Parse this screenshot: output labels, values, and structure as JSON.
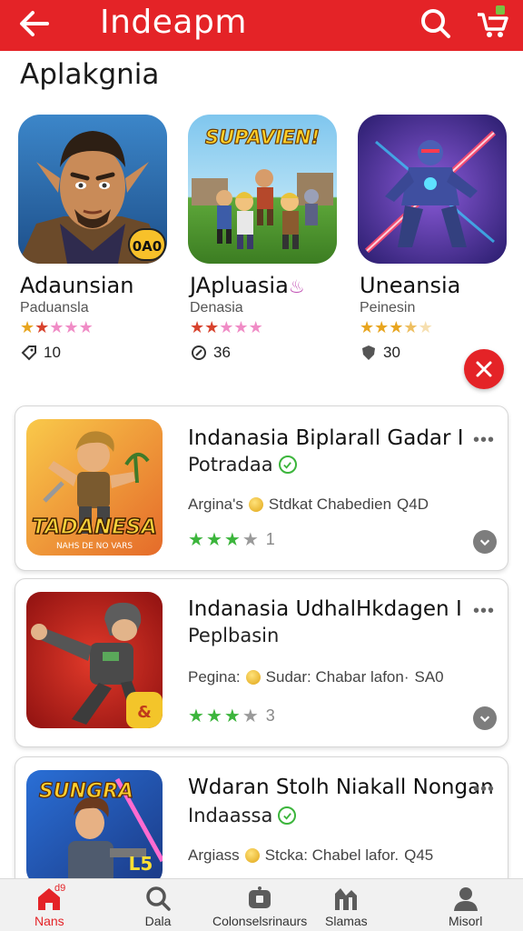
{
  "header": {
    "title": "Indeapm",
    "background": "#e42327"
  },
  "section": {
    "title": "Aplakgnia"
  },
  "featured": [
    {
      "name": "Adaunsian",
      "developer": "Paduansla",
      "rating": 2,
      "downloads": "10",
      "badge": "0A0",
      "icon": "game-thumbnail-warrior"
    },
    {
      "name": "JApluasia",
      "developer": "Denasia",
      "rating": 2,
      "downloads": "36",
      "banner": "SUPAVIEN!",
      "icon": "game-thumbnail-heroes"
    },
    {
      "name": "Uneansia",
      "developer": "Peinesin",
      "rating": 3,
      "downloads": "30",
      "icon": "game-thumbnail-robot"
    }
  ],
  "list": [
    {
      "title": "Indanasia Biplarall Gadar I",
      "subtitle": "Potradaa",
      "meta_prefix": "Argina's",
      "meta_text": "Stdkat Chabedien",
      "meta_value": "Q4D",
      "rating": 3,
      "rating_count": "1",
      "icon_banner": "TADANESA",
      "icon_sub": "NAHS DE NO VARS"
    },
    {
      "title": "Indanasia UdhalHkdagen I",
      "subtitle": "Peplbasin",
      "meta_prefix": "Pegina:",
      "meta_text": "Sudar: Chabar lafon·",
      "meta_value": "SA0",
      "rating": 3,
      "rating_count": "3"
    },
    {
      "title": "Wdaran Stolh Niakall Nongan",
      "subtitle": "Indaassa",
      "meta_prefix": "Argiass",
      "meta_text": "Stcka: Chabel lafor.",
      "meta_value": "Q45",
      "icon_banner": "SUNGRA",
      "icon_level": "L5"
    }
  ],
  "bottom_nav": [
    {
      "label": "Nans",
      "icon": "home-icon",
      "badge": "d9",
      "active": true
    },
    {
      "label": "Dala",
      "icon": "search-icon"
    },
    {
      "label": "Colonselsrinaurs",
      "icon": "controller-icon"
    },
    {
      "label": "Slamas",
      "icon": "chart-icon"
    },
    {
      "label": "Misorl",
      "icon": "profile-icon"
    }
  ],
  "colors": {
    "accent": "#e42327",
    "star_green": "#3cb53c",
    "star_gold": "#e8a51f",
    "star_pink": "#f08cc6"
  }
}
